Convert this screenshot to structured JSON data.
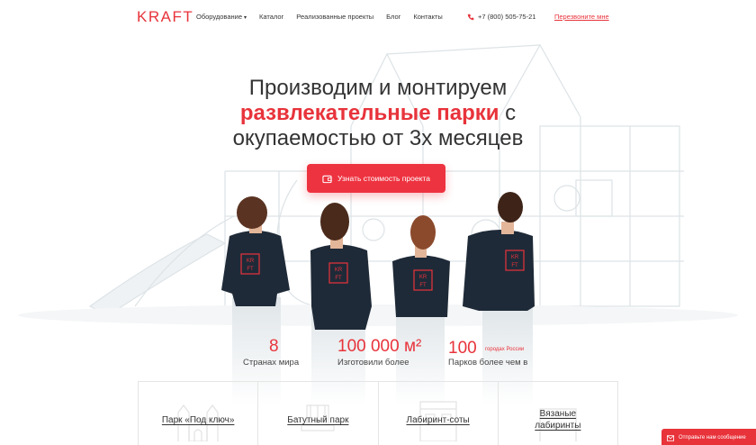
{
  "header": {
    "logo": "KRAFT",
    "nav": [
      {
        "label": "Оборудование",
        "caret": "▾"
      },
      {
        "label": "Каталог"
      },
      {
        "label": "Реализованные проекты"
      },
      {
        "label": "Блог"
      },
      {
        "label": "Контакты"
      }
    ],
    "phone": "+7 (800) 505-75-21",
    "callback": "Перезвоните мне"
  },
  "hero": {
    "line1": "Производим и монтируем",
    "accent": "развлекательные парки",
    "line2_suffix": " с",
    "line3": "окупаемостью от 3х месяцев",
    "cta_label": "Узнать стоимость проекта",
    "shirt_logo_top": "KR",
    "shirt_logo_bottom": "FT"
  },
  "stats": [
    {
      "number": "8",
      "label": "Странах мира"
    },
    {
      "number": "100 000 м²",
      "label": "Изготовили более"
    },
    {
      "number": "100",
      "sup": "городах России",
      "label": "Парков более чем в"
    }
  ],
  "cards": [
    {
      "label": "Парк «Под ключ»"
    },
    {
      "label": "Батутный парк"
    },
    {
      "label": "Лабиринт-соты"
    },
    {
      "label_line1": "Вязаные",
      "label_line2": "лабиринты"
    }
  ],
  "chat": {
    "label": "Отправьте нам сообщение"
  },
  "colors": {
    "accent": "#e8333b",
    "text": "#333333",
    "shirt": "#1f2a38"
  }
}
